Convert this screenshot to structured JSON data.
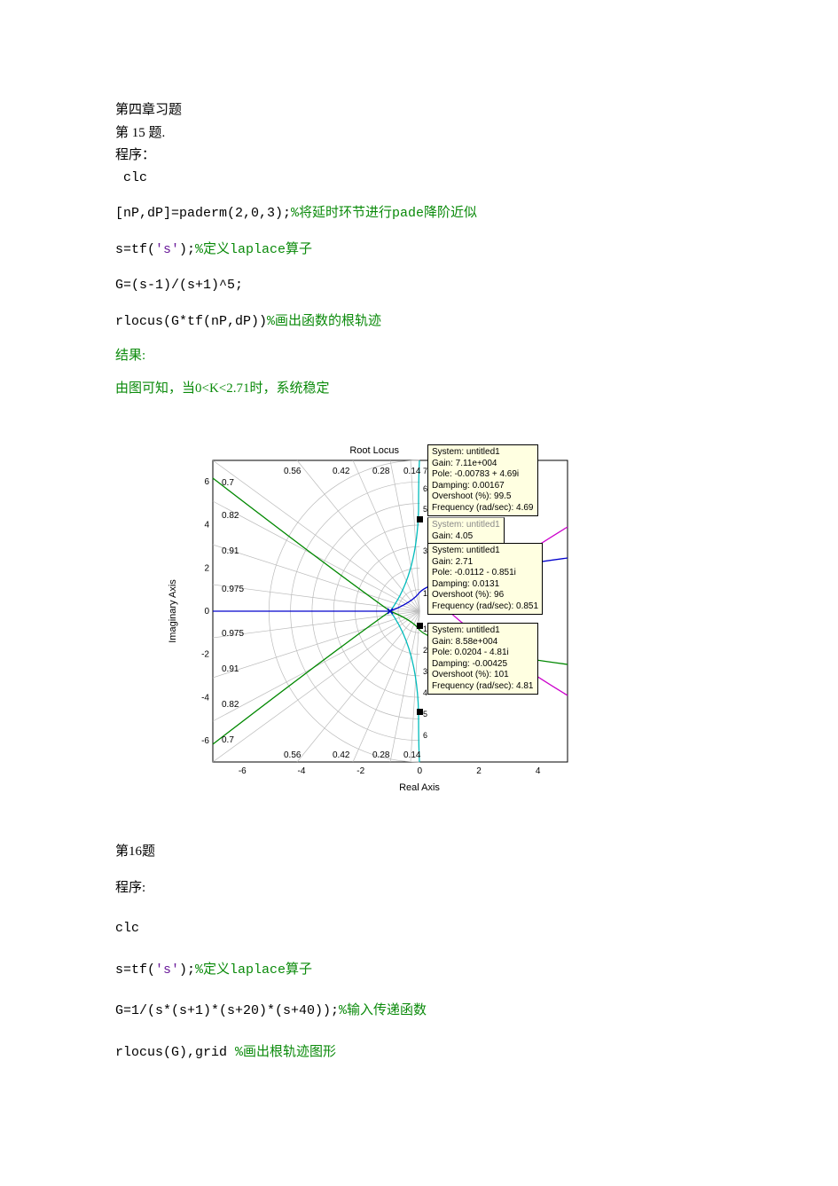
{
  "text": {
    "chapter": "第四章习题",
    "q15title": "第 15 题.",
    "programLabel": "程序：",
    "l_clc": " clc",
    "l_pade_code": "[nP,dP]=paderm(2,0,3);",
    "l_pade_cmt": "%将延时环节进行pade降阶近似",
    "l_stf_code": "s=tf(",
    "l_stf_str": "'s'",
    "l_stf_code2": ");",
    "l_stf_cmt": "%定义laplace算子",
    "l_G_code": "G=(s-1)/(s+1)^5;",
    "l_rlocus_code": "rlocus(G*tf(nP,dP))",
    "l_rlocus_cmt": "%画出函数的根轨迹",
    "resultLabel": "结果:",
    "conclusion": "由图可知，当0<K<2.71时，系统稳定",
    "q16title": "第16题",
    "programLabel2": "程序:",
    "l_clc2": "clc",
    "l_stf2_code": "s=tf(",
    "l_stf2_str": "'s'",
    "l_stf2_code2": ");",
    "l_stf2_cmt": "%定义laplace算子",
    "l_G2_code": "G=1/(s*(s+1)*(s+20)*(s+40));",
    "l_G2_cmt": "%输入传递函数",
    "l_rlocus2_code": "rlocus(G),grid ",
    "l_rlocus2_cmt": "%画出根轨迹图形"
  },
  "chart_data": {
    "type": "rlocusplot",
    "title": "Root Locus",
    "xlabel": "Real Axis",
    "ylabel": "Imaginary Axis",
    "xlim": [
      -7,
      5
    ],
    "ylim": [
      -7,
      7
    ],
    "xticks": [
      -6,
      -4,
      -2,
      0,
      2,
      4
    ],
    "yticks": [
      -6,
      -4,
      -2,
      0,
      2,
      4,
      6
    ],
    "damping_labels_upper": [
      "0.56",
      "0.42",
      "0.28",
      "0.14"
    ],
    "damping_labels_lower": [
      "0.56",
      "0.42",
      "0.28",
      "0.14"
    ],
    "damping_labels_left_upper": [
      "0.7",
      "0.82",
      "0.91",
      "0.975"
    ],
    "damping_labels_left_lower": [
      "0.975",
      "0.91",
      "0.82",
      "0.7"
    ],
    "wn_labels": [
      "7",
      "6",
      "5",
      "3",
      "1",
      "1",
      "2",
      "3",
      "4",
      "5",
      "6"
    ],
    "tooltips": [
      {
        "id": "tip1",
        "lines": [
          "System: untitled1",
          "Gain: 7.11e+004",
          "Pole: -0.00783 + 4.69i",
          "Damping: 0.00167",
          "Overshoot (%): 99.5",
          "Frequency (rad/sec): 4.69"
        ]
      },
      {
        "id": "tip2",
        "lines": [
          "Gain: 4.05"
        ]
      },
      {
        "id": "tip3",
        "lines": [
          "System: untitled1",
          "Gain: 2.71",
          "Pole: -0.0112 - 0.851i",
          "Damping: 0.0131",
          "Overshoot (%): 96",
          "Frequency (rad/sec): 0.851"
        ]
      },
      {
        "id": "tip4",
        "lines": [
          "System: untitled1",
          "Gain: 8.58e+004",
          "Pole: 0.0204 - 4.81i",
          "Damping: -0.00425",
          "Overshoot (%): 101",
          "Frequency (rad/sec): 4.81"
        ]
      }
    ]
  }
}
